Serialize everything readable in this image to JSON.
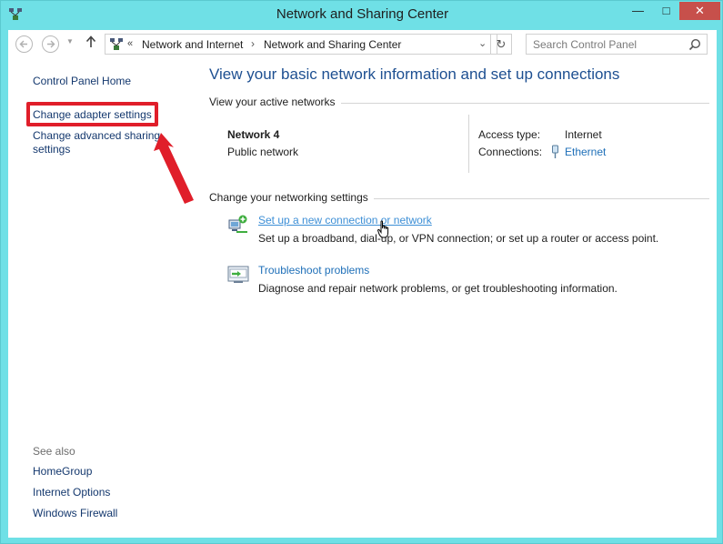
{
  "window": {
    "title": "Network and Sharing Center",
    "controls": {
      "minimize": "—",
      "maximize": "□",
      "close": "✕"
    }
  },
  "navbar": {
    "back_icon": "back-arrow-icon",
    "forward_icon": "forward-arrow-icon",
    "up_icon": "up-arrow-icon",
    "breadcrumb_overflow": "«",
    "breadcrumb": [
      "Network and Internet",
      "Network and Sharing Center"
    ],
    "breadcrumb_separator": "›",
    "search_placeholder": "Search Control Panel"
  },
  "sidebar": {
    "home": "Control Panel Home",
    "links": [
      "Change adapter settings",
      "Change advanced sharing settings"
    ],
    "see_also_label": "See also",
    "see_also": [
      "HomeGroup",
      "Internet Options",
      "Windows Firewall"
    ]
  },
  "main": {
    "title": "View your basic network information and set up connections",
    "active_networks_header": "View your active networks",
    "network": {
      "name": "Network  4",
      "type": "Public network",
      "access_type_label": "Access type:",
      "access_type_value": "Internet",
      "connections_label": "Connections:",
      "connections_value": "Ethernet"
    },
    "settings_header": "Change your networking settings",
    "tasks": [
      {
        "icon": "new-connection-icon",
        "link": "Set up a new connection or network",
        "desc": "Set up a broadband, dial-up, or VPN connection; or set up a router or access point."
      },
      {
        "icon": "troubleshoot-icon",
        "link": "Troubleshoot problems",
        "desc": "Diagnose and repair network problems, or get troubleshooting information."
      }
    ]
  },
  "colors": {
    "window_frame": "#6fe0e6",
    "link": "#1e6fb8",
    "title_blue": "#1d4f91",
    "highlight_red": "#e01e2a",
    "close_button": "#c7504b"
  }
}
